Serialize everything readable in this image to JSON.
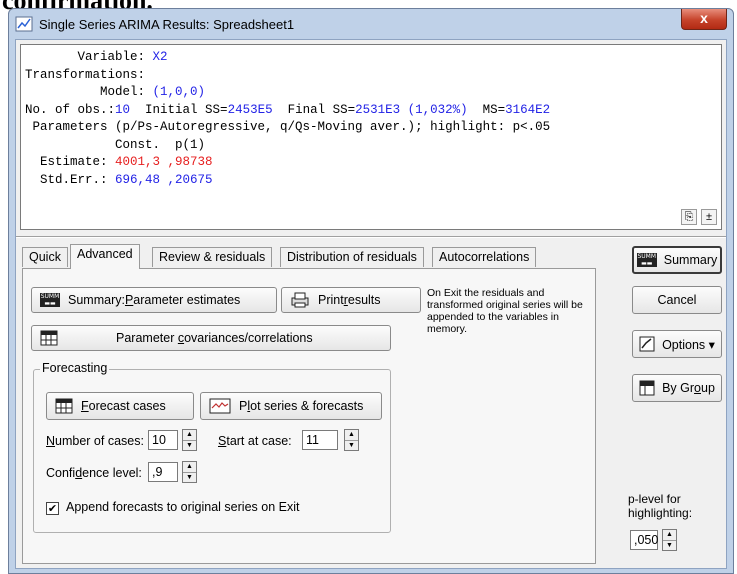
{
  "background_text": "confirmation.",
  "window": {
    "title": "Single Series ARIMA Results: Spreadsheet1",
    "close_label": "x"
  },
  "results": {
    "line1_label": "       Variable: ",
    "line1_value": "X2",
    "line2_label": "Transformations:",
    "line3_label": "          Model: ",
    "line3_value": "(1,0,0)",
    "line4_a": "No. of obs.:",
    "line4_b": "10",
    "line4_c": "  Initial SS=",
    "line4_d": "2453E5",
    "line4_e": "  Final SS=",
    "line4_f": "2531E3 (1,032%)",
    "line4_g": "  MS=",
    "line4_h": "3164E2",
    "line5": " Parameters (p/Ps-Autoregressive, q/Qs-Moving aver.); highlight: p<.05",
    "line6": "            Const.  p(1)",
    "line7_label": "  Estimate: ",
    "line7_value": "4001,3 ,98738",
    "line8_label": "  Std.Err.: ",
    "line8_value": "696,48 ,20675",
    "copy_icon_label": "⎘",
    "plusminus_label": "±"
  },
  "tabs": [
    "Quick",
    "Advanced",
    "Review & residuals",
    "Distribution of residuals",
    "Autocorrelations"
  ],
  "advanced": {
    "summary_param_label": "Summary: ",
    "summary_param_u": "P",
    "summary_param_rest": "arameter estimates",
    "print_label_a": "Print ",
    "print_label_u": "r",
    "print_label_b": "esults",
    "note": "On Exit the residuals and transformed original series will be appended to the variables in memory.",
    "covar_label_a": "Parameter ",
    "covar_label_u": "c",
    "covar_label_b": "ovariances/correlations",
    "forecasting_title": "Forecasting",
    "forecast_cases_u": "F",
    "forecast_cases_rest": "orecast cases",
    "plot_label_a": "P",
    "plot_label_u": "l",
    "plot_label_b": "ot series & forecasts",
    "num_cases_u": "N",
    "num_cases_rest": "umber of cases:",
    "num_cases_value": "10",
    "start_u": "S",
    "start_rest": "tart at case:",
    "start_value": "11",
    "conf_a": "Confi",
    "conf_u": "d",
    "conf_b": "ence level:",
    "conf_value": ",9",
    "append_label": "Append forecasts to original series on Exit",
    "append_checked": "✔"
  },
  "right": {
    "summary_label": "Summary",
    "cancel_label": "Cancel",
    "options_label": "Options ▾",
    "bygroup_a": "By Gr",
    "bygroup_u": "o",
    "bygroup_b": "up",
    "plevel_line1": "p-level for",
    "plevel_line2": "highlighting:",
    "plevel_value": ",050"
  }
}
